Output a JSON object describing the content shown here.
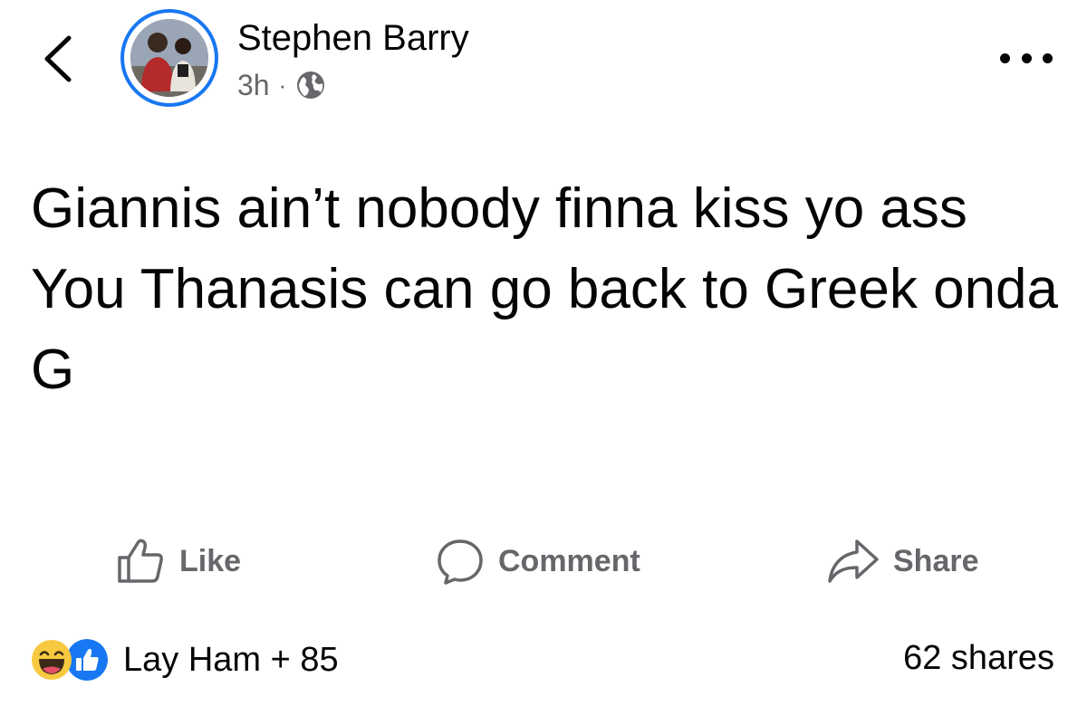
{
  "header": {
    "back_icon": "chevron-left-icon",
    "author_name": "Stephen Barry",
    "time": "3h",
    "separator": "·",
    "audience_icon": "globe-icon",
    "more_icon": "more-horizontal-icon"
  },
  "post": {
    "lines": [
      "Giannis ain’t nobody finna kiss yo ass",
      "You Thanasis can go back to Greek onda G"
    ]
  },
  "actions": {
    "like_label": "Like",
    "comment_label": "Comment",
    "share_label": "Share"
  },
  "footer": {
    "reaction_icons": [
      "haha-emoji-icon",
      "like-reaction-icon"
    ],
    "reaction_text": "Lay Ham + 85",
    "shares_text": "62 shares"
  },
  "colors": {
    "accent": "#1877f2",
    "text": "#050505",
    "secondary_text": "#65676b"
  }
}
